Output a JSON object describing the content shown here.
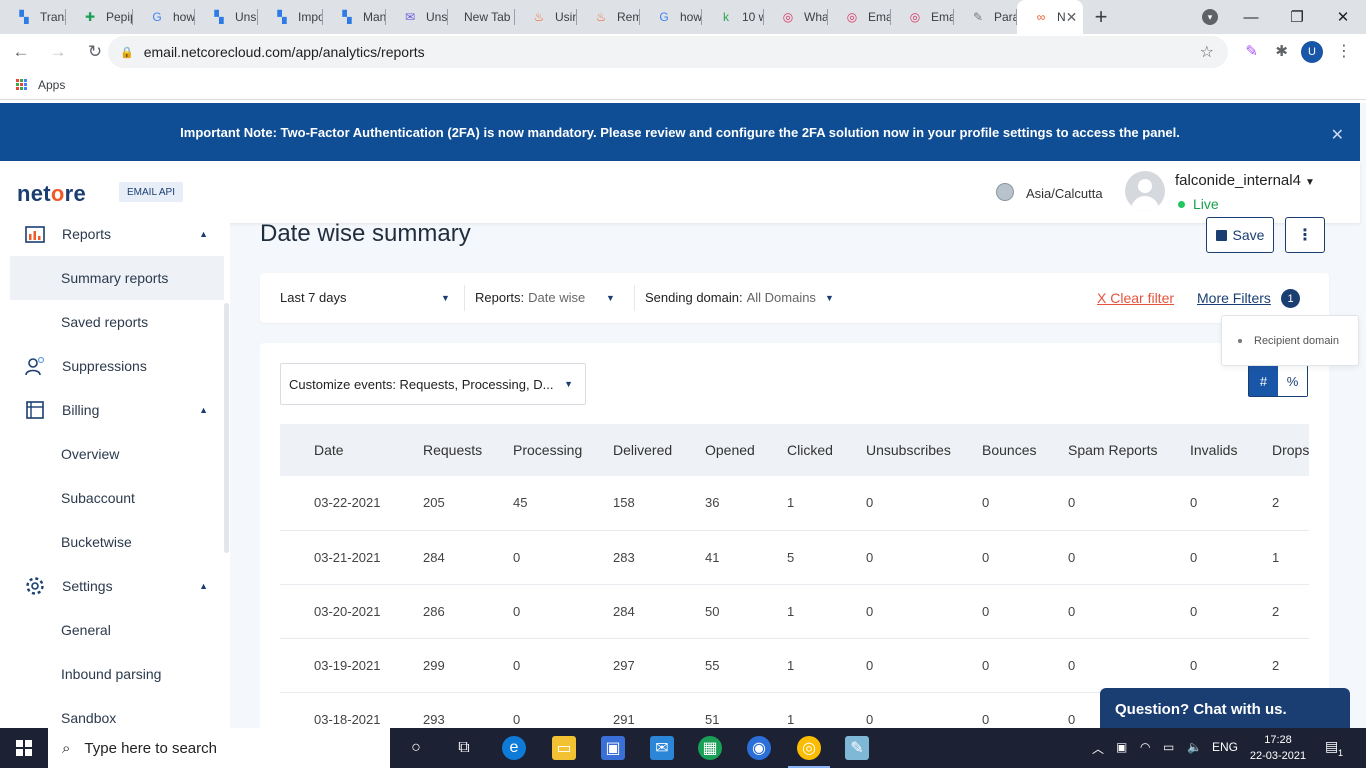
{
  "browser": {
    "tabs": [
      {
        "label": "Trans",
        "icon": "app-icon"
      },
      {
        "label": "Pepip",
        "icon": "sheets-icon"
      },
      {
        "label": "how",
        "icon": "google-icon"
      },
      {
        "label": "Unsu",
        "icon": "app-icon"
      },
      {
        "label": "Impo",
        "icon": "app-icon"
      },
      {
        "label": "Man",
        "icon": "app-icon"
      },
      {
        "label": "Unsu",
        "icon": "mail-icon"
      },
      {
        "label": "New Tab",
        "icon": ""
      },
      {
        "label": "Usin",
        "icon": "flame-icon"
      },
      {
        "label": "Rem",
        "icon": "flame-icon"
      },
      {
        "label": "how",
        "icon": "google-icon"
      },
      {
        "label": "10 w",
        "icon": "k-icon"
      },
      {
        "label": "Wha",
        "icon": "target-icon"
      },
      {
        "label": "Ema",
        "icon": "target-icon"
      },
      {
        "label": "Ema",
        "icon": "target-icon"
      },
      {
        "label": "Para",
        "icon": "pen-icon"
      },
      {
        "label": "N",
        "icon": "infinity-icon"
      }
    ],
    "url": "email.netcorecloud.com/app/analytics/reports",
    "profile_initial": "U",
    "bookmarks_apps": "Apps"
  },
  "notice": {
    "text": "Important Note: Two-Factor Authentication (2FA) is now mandatory. Please review and configure the 2FA solution now in your profile settings to access the panel."
  },
  "header": {
    "logo_pre": "net",
    "logo_o": "o",
    "logo_post": "re",
    "badge": "EMAIL API",
    "timezone": "Asia/Calcutta",
    "username": "falconide_internal4",
    "status": "Live"
  },
  "sidebar": {
    "reports": "Reports",
    "summary_reports": "Summary reports",
    "saved_reports": "Saved reports",
    "suppressions": "Suppressions",
    "billing": "Billing",
    "overview": "Overview",
    "subaccount": "Subaccount",
    "bucketwise": "Bucketwise",
    "settings": "Settings",
    "general": "General",
    "inbound_parsing": "Inbound parsing",
    "sandbox": "Sandbox"
  },
  "main": {
    "title": "Date wise summary",
    "save_label": "Save",
    "filters": {
      "period": "Last 7 days",
      "reports_label": "Reports:",
      "reports_value": "Date wise",
      "domain_label": "Sending domain:",
      "domain_value": "All Domains",
      "clear_filter": "X Clear filter",
      "more_filters": "More Filters",
      "more_count": "1",
      "tooltip_item": "Recipient domain"
    },
    "customize": "Customize events: Requests, Processing, D...",
    "toggle": {
      "count": "#",
      "percent": "%"
    },
    "chat": "Question? Chat with us."
  },
  "table": {
    "columns": [
      "Date",
      "Requests",
      "Processing",
      "Delivered",
      "Opened",
      "Clicked",
      "Unsubscribes",
      "Bounces",
      "Spam Reports",
      "Invalids",
      "Drops"
    ],
    "rows": [
      [
        "03-22-2021",
        "205",
        "45",
        "158",
        "36",
        "1",
        "0",
        "0",
        "0",
        "0",
        "2"
      ],
      [
        "03-21-2021",
        "284",
        "0",
        "283",
        "41",
        "5",
        "0",
        "0",
        "0",
        "0",
        "1"
      ],
      [
        "03-20-2021",
        "286",
        "0",
        "284",
        "50",
        "1",
        "0",
        "0",
        "0",
        "0",
        "2"
      ],
      [
        "03-19-2021",
        "299",
        "0",
        "297",
        "55",
        "1",
        "0",
        "0",
        "0",
        "0",
        "2"
      ],
      [
        "03-18-2021",
        "293",
        "0",
        "291",
        "51",
        "1",
        "0",
        "0",
        "0",
        "",
        ""
      ]
    ]
  },
  "taskbar": {
    "search_placeholder": "Type here to search",
    "language": "ENG",
    "time": "17:28",
    "date": "22-03-2021",
    "notifications": "1"
  }
}
